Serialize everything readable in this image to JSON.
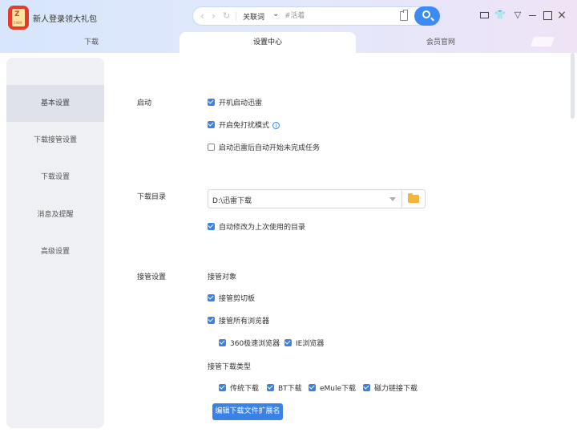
{
  "header": {
    "promo_text": "新人登录领大礼包",
    "logo_glyph": "Z",
    "logo_small": "1989",
    "logo_color": "#e53b2d",
    "accent_color": "#3b8bf2"
  },
  "search": {
    "mode": "关联词",
    "placeholder": "#活着"
  },
  "window_controls": [
    "mail-icon",
    "shirt-icon",
    "menu-icon",
    "minimize-icon",
    "maximize-icon",
    "close-icon"
  ],
  "tabs": [
    {
      "label": "下载",
      "active": false
    },
    {
      "label": "设置中心",
      "active": true
    },
    {
      "label": "会员官网",
      "active": false
    }
  ],
  "sidebar": {
    "items": [
      {
        "label": "基本设置",
        "active": true
      },
      {
        "label": "下载接管设置",
        "active": false
      },
      {
        "label": "下载设置",
        "active": false
      },
      {
        "label": "消息及提醒",
        "active": false
      },
      {
        "label": "高级设置",
        "active": false
      }
    ]
  },
  "settings": {
    "startup": {
      "label": "启动",
      "options": [
        {
          "label": "开机启动迅雷",
          "checked": true
        },
        {
          "label": "开启免打扰模式",
          "checked": true
        },
        {
          "label": "启动迅雷后自动开始未完成任务",
          "checked": false
        }
      ]
    },
    "download_dir": {
      "label": "下载目录",
      "value": "D:\\迅雷下载",
      "auto_update": {
        "label": "自动修改为上次使用的目录",
        "checked": true
      }
    },
    "takeover": {
      "label": "接管设置",
      "target_label": "接管对象",
      "clipboard": {
        "label": "接管剪切板",
        "checked": true
      },
      "all_browsers": {
        "label": "接管所有浏览器",
        "checked": true
      },
      "browsers": [
        {
          "label": "360极速浏览器",
          "checked": true
        },
        {
          "label": "IE浏览器",
          "checked": true
        }
      ],
      "type_label": "接管下载类型",
      "types": [
        {
          "label": "传统下载",
          "checked": true
        },
        {
          "label": "BT下载",
          "checked": true
        },
        {
          "label": "eMule下载",
          "checked": true
        },
        {
          "label": "磁力链接下载",
          "checked": true
        }
      ],
      "edit_ext_button": "编辑下载文件扩展名"
    }
  }
}
